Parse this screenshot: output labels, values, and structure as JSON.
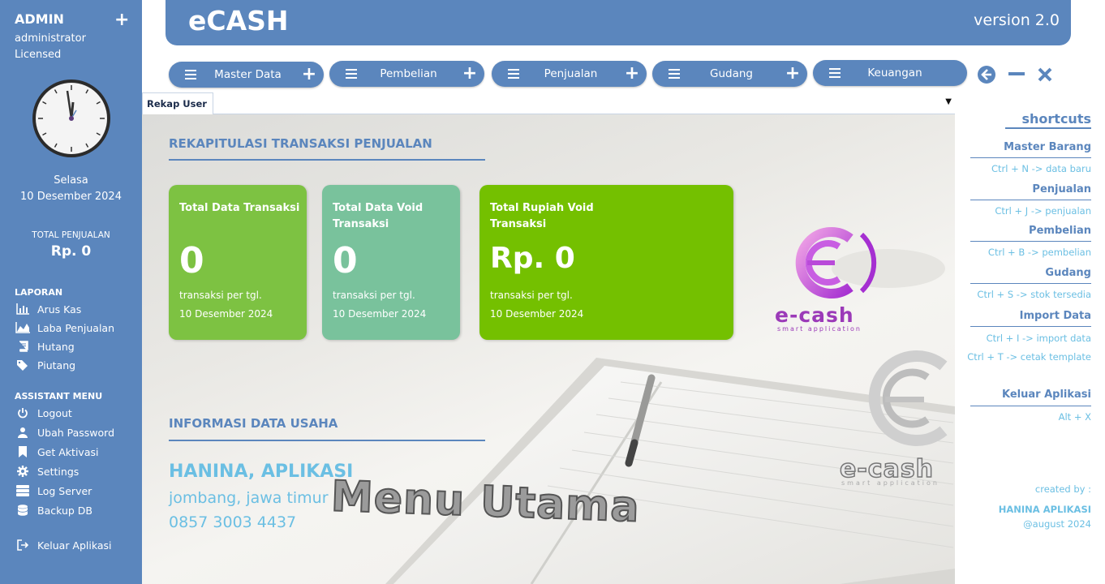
{
  "sidebar": {
    "user": "ADMIN",
    "role": "administrator",
    "license": "Licensed",
    "day": "Selasa",
    "date": "10 Desember 2024",
    "total_label": "TOTAL PENJUALAN",
    "total_value": "Rp. 0",
    "laporan_title": "LAPORAN",
    "laporan_items": [
      "Arus Kas",
      "Laba Penjualan",
      "Hutang",
      "Piutang"
    ],
    "assistant_title": "ASSISTANT MENU",
    "assistant_items": [
      "Logout",
      "Ubah Password",
      "Get Aktivasi",
      "Settings",
      "Log Server",
      "Backup DB"
    ],
    "exit_label": "Keluar Aplikasi"
  },
  "header": {
    "title": "eCASH",
    "version": "version 2.0"
  },
  "menubar": [
    "Master Data",
    "Pembelian",
    "Penjualan",
    "Gudang",
    "Keuangan"
  ],
  "tabs": {
    "active": "Rekap User"
  },
  "main": {
    "section1_title": "REKAPITULASI TRANSAKSI PENJUALAN",
    "cards": [
      {
        "title": "Total Data Transaksi",
        "value": "0",
        "sub": "transaksi per tgl.",
        "date": "10 Desember 2024",
        "color": "#7dc242"
      },
      {
        "title": "Total Data Void Transaksi",
        "value": "0",
        "sub": "transaksi per tgl.",
        "date": "10 Desember 2024",
        "color": "#79c29c"
      },
      {
        "title": "Total Rupiah Void Transaksi",
        "value": "Rp. 0",
        "sub": "transaksi per tgl.",
        "date": "10 Desember 2024",
        "color": "#74c000"
      }
    ],
    "section2_title": "INFORMASI DATA USAHA",
    "business_name": "HANINA, APLIKASI",
    "business_address": "jombang, jawa timur",
    "business_phone": "0857 3003 4437",
    "watermark": "Menu Utama",
    "logo_text": "e-cash",
    "logo_tagline": "smart application"
  },
  "shortcuts": {
    "title": "shortcuts",
    "groups": [
      {
        "name": "Master Barang",
        "items": [
          "Ctrl + N -> data baru"
        ]
      },
      {
        "name": "Penjualan",
        "items": [
          "Ctrl + J -> penjualan"
        ]
      },
      {
        "name": "Pembelian",
        "items": [
          "Ctrl + B -> pembelian"
        ]
      },
      {
        "name": "Gudang",
        "items": [
          "Ctrl + S -> stok tersedia"
        ]
      },
      {
        "name": "Import Data",
        "items": [
          "Ctrl + I -> import data",
          "Ctrl + T -> cetak template"
        ]
      },
      {
        "name": "Keluar Aplikasi",
        "items": [
          "Alt + X"
        ]
      }
    ],
    "created_by": "created by :",
    "author": "HANINA APLIKASI",
    "created_date": "@august 2024"
  },
  "colors": {
    "primary": "#5b86bd",
    "accent_text": "#6bbfe3"
  }
}
